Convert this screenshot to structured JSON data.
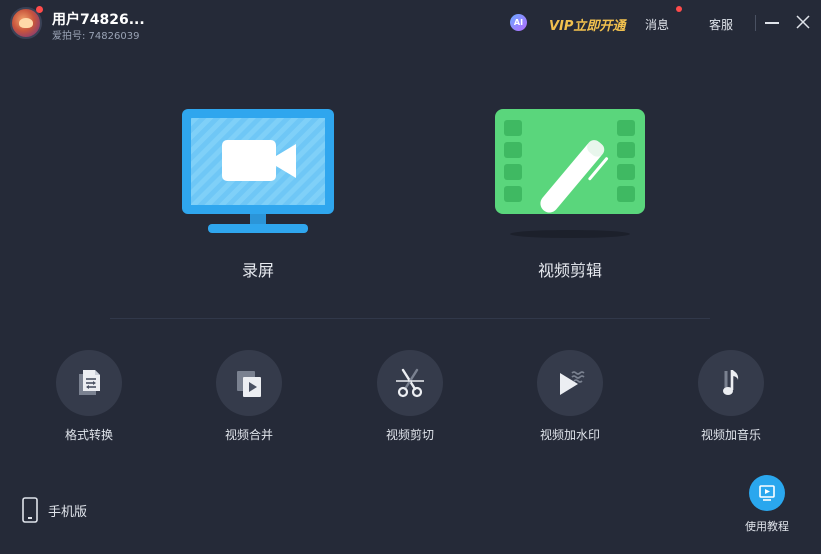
{
  "header": {
    "username": "用户74826...",
    "user_id_label": "爱拍号: 74826039",
    "ai_badge": "AI",
    "vip_label": "VIP立即开通",
    "messages_label": "消息",
    "service_label": "客服"
  },
  "features": {
    "record": {
      "label": "录屏"
    },
    "edit": {
      "label": "视频剪辑"
    }
  },
  "tools": [
    {
      "label": "格式转换",
      "icon": "file-convert-icon"
    },
    {
      "label": "视频合并",
      "icon": "video-merge-icon"
    },
    {
      "label": "视频剪切",
      "icon": "scissors-icon"
    },
    {
      "label": "视频加水印",
      "icon": "watermark-icon"
    },
    {
      "label": "视频加音乐",
      "icon": "music-note-icon"
    }
  ],
  "footer": {
    "mobile_label": "手机版",
    "tutorial_label": "使用教程"
  },
  "colors": {
    "background": "#252a38",
    "record_blue": "#2fa6ee",
    "edit_green": "#5ad67c",
    "vip_gold": "#f2c14e",
    "notify_red": "#ff4b4b",
    "tool_circle": "#353b4b"
  }
}
